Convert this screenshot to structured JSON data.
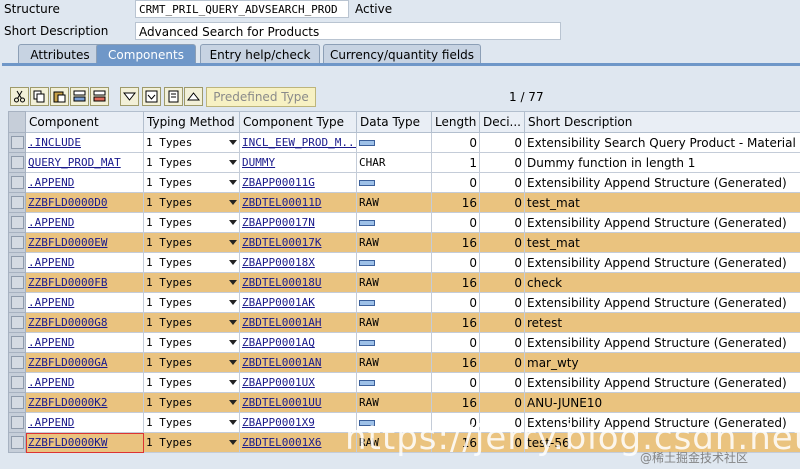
{
  "header": {
    "structure_label": "Structure",
    "structure_value": "CRMT_PRIL_QUERY_ADVSEARCH_PROD",
    "status": "Active",
    "short_desc_label": "Short Description",
    "short_desc_value": "Advanced Search for Products"
  },
  "tabs": [
    {
      "label": "Attributes"
    },
    {
      "label": "Components"
    },
    {
      "label": "Entry help/check"
    },
    {
      "label": "Currency/quantity fields"
    }
  ],
  "toolbar": {
    "predefined_type_label": "Predefined Type",
    "pager": "1 / 77"
  },
  "columns": [
    "Component",
    "Typing Method",
    "Component Type",
    "Data Type",
    "Length",
    "Deci...",
    "Short Description"
  ],
  "rows": [
    {
      "component": ".INCLUDE",
      "typing": "1 Types",
      "ctype": "INCL_EEW_PROD_M...",
      "dtype": "",
      "length": "0",
      "dec": "0",
      "desc": "Extensibility Search Query Product - Material",
      "hl": false
    },
    {
      "component": "QUERY_PROD_MAT",
      "typing": "1 Types",
      "ctype": "DUMMY",
      "dtype": "CHAR",
      "length": "1",
      "dec": "0",
      "desc": "Dummy function in length 1",
      "hl": false
    },
    {
      "component": ".APPEND",
      "typing": "1 Types",
      "ctype": "ZBAPP00011G",
      "dtype": "",
      "length": "0",
      "dec": "0",
      "desc": "Extensibility Append Structure (Generated)",
      "hl": false
    },
    {
      "component": "ZZBFLD0000D0",
      "typing": "1 Types",
      "ctype": "ZBDTEL00011D",
      "dtype": "RAW",
      "length": "16",
      "dec": "0",
      "desc": "test_mat",
      "hl": true
    },
    {
      "component": ".APPEND",
      "typing": "1 Types",
      "ctype": "ZBAPP00017N",
      "dtype": "",
      "length": "0",
      "dec": "0",
      "desc": "Extensibility Append Structure (Generated)",
      "hl": false
    },
    {
      "component": "ZZBFLD0000EW",
      "typing": "1 Types",
      "ctype": "ZBDTEL00017K",
      "dtype": "RAW",
      "length": "16",
      "dec": "0",
      "desc": "test_mat",
      "hl": true
    },
    {
      "component": ".APPEND",
      "typing": "1 Types",
      "ctype": "ZBAPP00018X",
      "dtype": "",
      "length": "0",
      "dec": "0",
      "desc": "Extensibility Append Structure (Generated)",
      "hl": false
    },
    {
      "component": "ZZBFLD0000FB",
      "typing": "1 Types",
      "ctype": "ZBDTEL00018U",
      "dtype": "RAW",
      "length": "16",
      "dec": "0",
      "desc": "check",
      "hl": true
    },
    {
      "component": ".APPEND",
      "typing": "1 Types",
      "ctype": "ZBAPP0001AK",
      "dtype": "",
      "length": "0",
      "dec": "0",
      "desc": "Extensibility Append Structure (Generated)",
      "hl": false
    },
    {
      "component": "ZZBFLD0000G8",
      "typing": "1 Types",
      "ctype": "ZBDTEL0001AH",
      "dtype": "RAW",
      "length": "16",
      "dec": "0",
      "desc": "retest",
      "hl": true
    },
    {
      "component": ".APPEND",
      "typing": "1 Types",
      "ctype": "ZBAPP0001AQ",
      "dtype": "",
      "length": "0",
      "dec": "0",
      "desc": "Extensibility Append Structure (Generated)",
      "hl": false
    },
    {
      "component": "ZZBFLD0000GA",
      "typing": "1 Types",
      "ctype": "ZBDTEL0001AN",
      "dtype": "RAW",
      "length": "16",
      "dec": "0",
      "desc": "mar_wty",
      "hl": true
    },
    {
      "component": ".APPEND",
      "typing": "1 Types",
      "ctype": "ZBAPP0001UX",
      "dtype": "",
      "length": "0",
      "dec": "0",
      "desc": "Extensibility Append Structure (Generated)",
      "hl": false
    },
    {
      "component": "ZZBFLD0000K2",
      "typing": "1 Types",
      "ctype": "ZBDTEL0001UU",
      "dtype": "RAW",
      "length": "16",
      "dec": "0",
      "desc": "ANU-JUNE10",
      "hl": true
    },
    {
      "component": ".APPEND",
      "typing": "1 Types",
      "ctype": "ZBAPP0001X9",
      "dtype": "",
      "length": "0",
      "dec": "0",
      "desc": "Extensibility Append Structure (Generated)",
      "hl": false
    },
    {
      "component": "ZZBFLD0000KW",
      "typing": "1 Types",
      "ctype": "ZBDTEL0001X6",
      "dtype": "RAW",
      "length": "16",
      "dec": "0",
      "desc": "test-56",
      "hl": true
    }
  ],
  "watermark": {
    "main": "https://jerry.blog.csdn.net",
    "sub": "@稀土掘金技术社区"
  },
  "colors": {
    "highlight_row": "#eac37f",
    "active_tab": "#6f97c8"
  }
}
